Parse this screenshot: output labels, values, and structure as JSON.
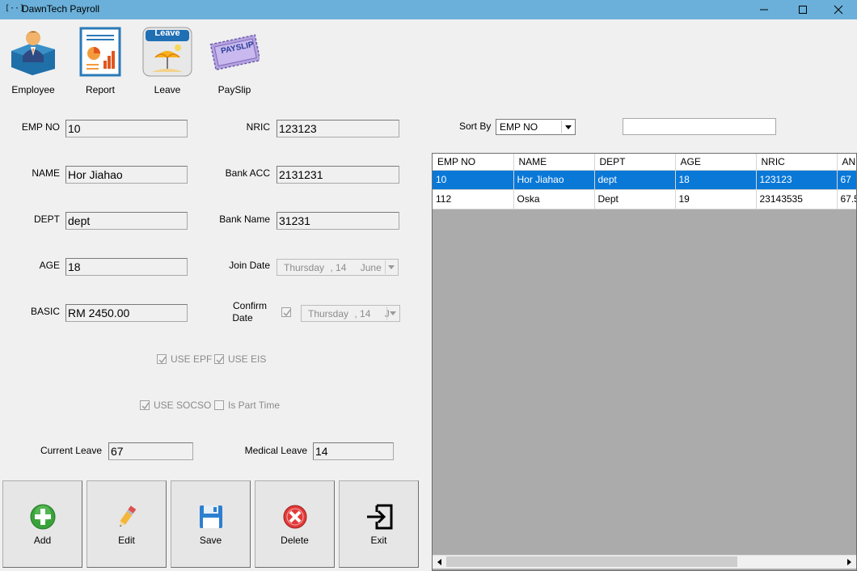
{
  "window": {
    "title": "DawnTech Payroll",
    "icon_glyph": "[··]"
  },
  "toolbar": {
    "employee": "Employee",
    "report": "Report",
    "leave": "Leave",
    "leave_icon_text": "Leave",
    "payslip": "PaySlip",
    "payslip_icon_text": "PAYSLIP"
  },
  "form": {
    "emp_no_label": "EMP NO",
    "emp_no": "10",
    "name_label": "NAME",
    "name": "Hor Jiahao",
    "dept_label": "DEPT",
    "dept": "dept",
    "age_label": "AGE",
    "age": "18",
    "basic_label": "BASIC",
    "basic": "RM 2450.00",
    "nric_label": "NRIC",
    "nric": "123123",
    "bank_acc_label": "Bank ACC",
    "bank_acc": "2131231",
    "bank_name_label": "Bank Name",
    "bank_name": "31231",
    "join_date_label": "Join Date",
    "join_date_day": "Thursday",
    "join_date_num": ", 14",
    "join_date_month": "June",
    "confirm_date_label_1": "Confirm",
    "confirm_date_label_2": "Date",
    "confirm_date_day": "Thursday",
    "confirm_date_num": ", 14",
    "confirm_date_month": "J",
    "use_epf": "USE EPF",
    "use_eis": "USE EIS",
    "use_socso": "USE SOCSO",
    "is_part_time": "Is Part Time",
    "current_leave_label": "Current Leave",
    "current_leave": "67",
    "medical_leave_label": "Medical Leave",
    "medical_leave": "14"
  },
  "checks": {
    "use_epf": true,
    "use_eis": true,
    "use_socso": true,
    "is_part_time": false,
    "confirm_date": true
  },
  "actions": {
    "add": "Add",
    "edit": "Edit",
    "save": "Save",
    "delete": "Delete",
    "exit": "Exit"
  },
  "sort": {
    "label": "Sort By",
    "selected": "EMP NO",
    "search_value": ""
  },
  "grid": {
    "columns": [
      "EMP NO",
      "NAME",
      "DEPT",
      "AGE",
      "NRIC",
      "AN"
    ],
    "rows": [
      [
        "10",
        "Hor Jiahao",
        "dept",
        "18",
        "123123",
        "67"
      ],
      [
        "112",
        "Oska",
        "Dept",
        "19",
        "23143535",
        "67.5"
      ]
    ],
    "selected_row": 0
  },
  "colors": {
    "titlebar": "#6ab0da",
    "selection": "#0a78d7",
    "grid_bg": "#ababab",
    "window_bg": "#f0f0f0"
  }
}
